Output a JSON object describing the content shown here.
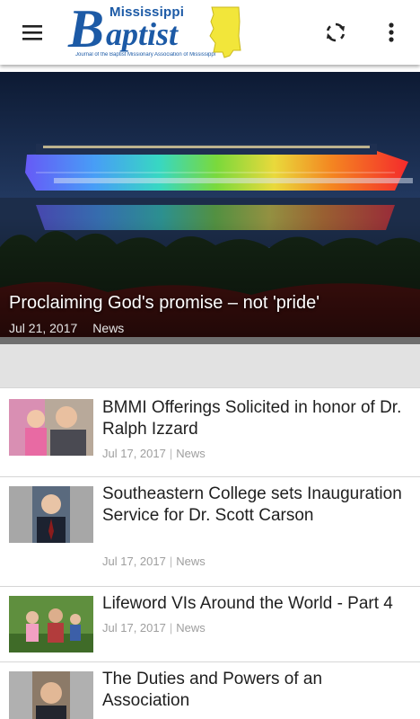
{
  "header": {
    "menu_icon": "hamburger-menu-icon",
    "logo": {
      "state_text": "Mississippi",
      "b_letter": "B",
      "word_text": "aptist",
      "tagline": "Journal of the Baptist Missionary Association of Mississippi"
    },
    "refresh_icon": "refresh-icon",
    "more_icon": "more-vertical-icon"
  },
  "featured": {
    "title": "Proclaiming God's promise – not 'pride'",
    "date": "Jul 21, 2017",
    "category": "News"
  },
  "articles": [
    {
      "title": "BMMI Offerings Solicited in honor of Dr. Ralph Izzard",
      "date": "Jul 17, 2017",
      "separator": "|",
      "category": "News"
    },
    {
      "title": "Southeastern College sets Inauguration Service for Dr. Scott Carson",
      "date": "Jul 17, 2017",
      "separator": "|",
      "category": "News"
    },
    {
      "title": "Lifeword VIs Around the World - Part 4",
      "date": "Jul 17, 2017",
      "separator": "|",
      "category": "News"
    },
    {
      "title": "The Duties and Powers of an Association",
      "date": "",
      "separator": "",
      "category": ""
    }
  ],
  "colors": {
    "brand_blue": "#1c5aa6",
    "brand_yellow": "#f2e63a",
    "meta_gray": "#9e9e9e"
  }
}
